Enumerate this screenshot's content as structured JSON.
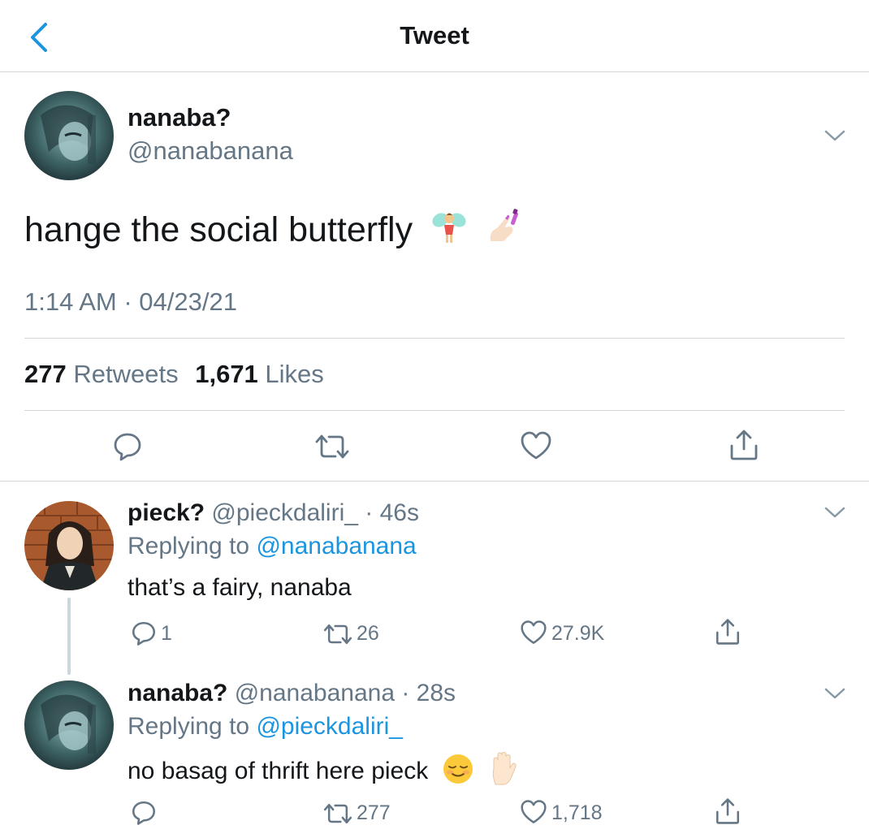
{
  "nav": {
    "title": "Tweet",
    "back_icon": "chevron-left-icon"
  },
  "colors": {
    "link": "#1b95e0",
    "muted": "#657786",
    "text": "#14171a",
    "divider": "#d3d7da"
  },
  "tweet": {
    "name": "nanaba?",
    "handle": "@nanabanana",
    "text": "hange the social butterfly",
    "emojis": [
      "fairy-emoji",
      "nail-polish-emoji"
    ],
    "timestamp": "1:14 AM · 04/23/21",
    "retweets_count": "277",
    "retweets_label": "Retweets",
    "likes_count": "1,671",
    "likes_label": "Likes"
  },
  "replies": [
    {
      "name": "pieck?",
      "handle": "@pieckdaliri_",
      "time": "· 46s",
      "replying_label": "Replying to",
      "replying_to": "@nanabanana",
      "text": "that’s a fairy, nanaba",
      "reply_count": "1",
      "retweet_count": "26",
      "like_count": "27.9K"
    },
    {
      "name": "nanaba?",
      "handle": "@nanabanana",
      "time": "· 28s",
      "replying_label": "Replying to",
      "replying_to": "@pieckdaliri_",
      "text": "no basag of thrift here pieck",
      "emojis": [
        "relieved-face-emoji",
        "raised-hand-emoji"
      ],
      "reply_count": "",
      "retweet_count": "277",
      "like_count": "1,718"
    }
  ]
}
